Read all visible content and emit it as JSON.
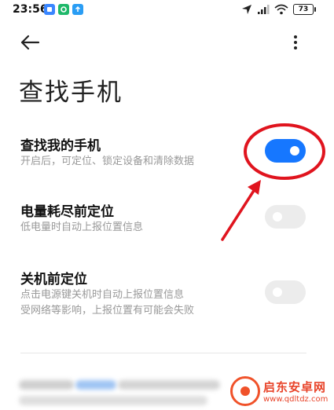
{
  "status_bar": {
    "time": "23:56",
    "battery": "73"
  },
  "page": {
    "title": "查找手机"
  },
  "settings": [
    {
      "title": "查找我的手机",
      "desc": [
        "开启后，可定位、锁定设备和清除数据"
      ],
      "enabled": true
    },
    {
      "title": "电量耗尽前定位",
      "desc": [
        "低电量时自动上报位置信息"
      ],
      "enabled": false
    },
    {
      "title": "关机前定位",
      "desc": [
        "点击电源键关机时自动上报位置信息",
        "受网络等影响，上报位置有可能会失败"
      ],
      "enabled": false
    }
  ],
  "watermark": {
    "name": "启东安卓网",
    "url": "www.qdltdz.com"
  },
  "colors": {
    "accent": "#1677ff",
    "annotation": "#e0141e",
    "toggle_off": "#ececec"
  },
  "icons": {
    "back": "arrow-left-icon",
    "more": "more-vertical-icon"
  }
}
